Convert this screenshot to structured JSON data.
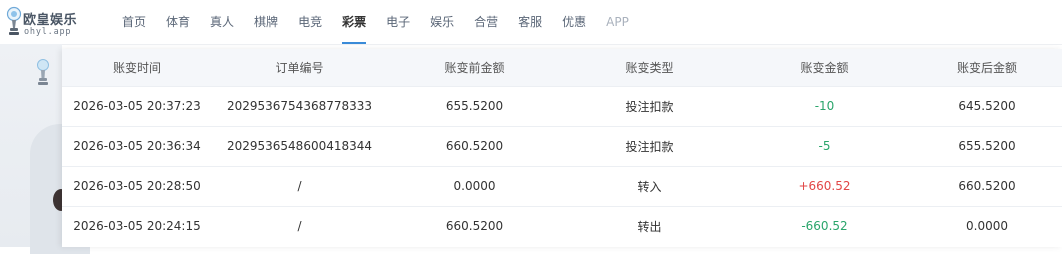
{
  "brand": {
    "name": "欧皇娱乐",
    "sub": "ohyl.app"
  },
  "nav": [
    {
      "label": "首页"
    },
    {
      "label": "体育"
    },
    {
      "label": "真人"
    },
    {
      "label": "棋牌"
    },
    {
      "label": "电竞"
    },
    {
      "label": "彩票",
      "active": true
    },
    {
      "label": "电子"
    },
    {
      "label": "娱乐"
    },
    {
      "label": "合营"
    },
    {
      "label": "客服"
    },
    {
      "label": "优惠"
    },
    {
      "label": "APP"
    }
  ],
  "table": {
    "headers": [
      "账变时间",
      "订单编号",
      "账变前金额",
      "账变类型",
      "账变金额",
      "账变后金额"
    ],
    "rows": [
      {
        "time": "2026-03-05 20:37:23",
        "order": "2029536754368778333",
        "before": "655.5200",
        "type": "投注扣款",
        "amount": "-10",
        "after": "645.5200"
      },
      {
        "time": "2026-03-05 20:36:34",
        "order": "2029536548600418344",
        "before": "660.5200",
        "type": "投注扣款",
        "amount": "-5",
        "after": "655.5200"
      },
      {
        "time": "2026-03-05 20:28:50",
        "order": "/",
        "before": "0.0000",
        "type": "转入",
        "amount": "+660.52",
        "after": "660.5200"
      },
      {
        "time": "2026-03-05 20:24:15",
        "order": "/",
        "before": "660.5200",
        "type": "转出",
        "amount": "-660.52",
        "after": "0.0000"
      }
    ]
  },
  "colors": {
    "positive": "#e24646",
    "negative": "#2aa56b",
    "accent": "#3a8bd8"
  }
}
